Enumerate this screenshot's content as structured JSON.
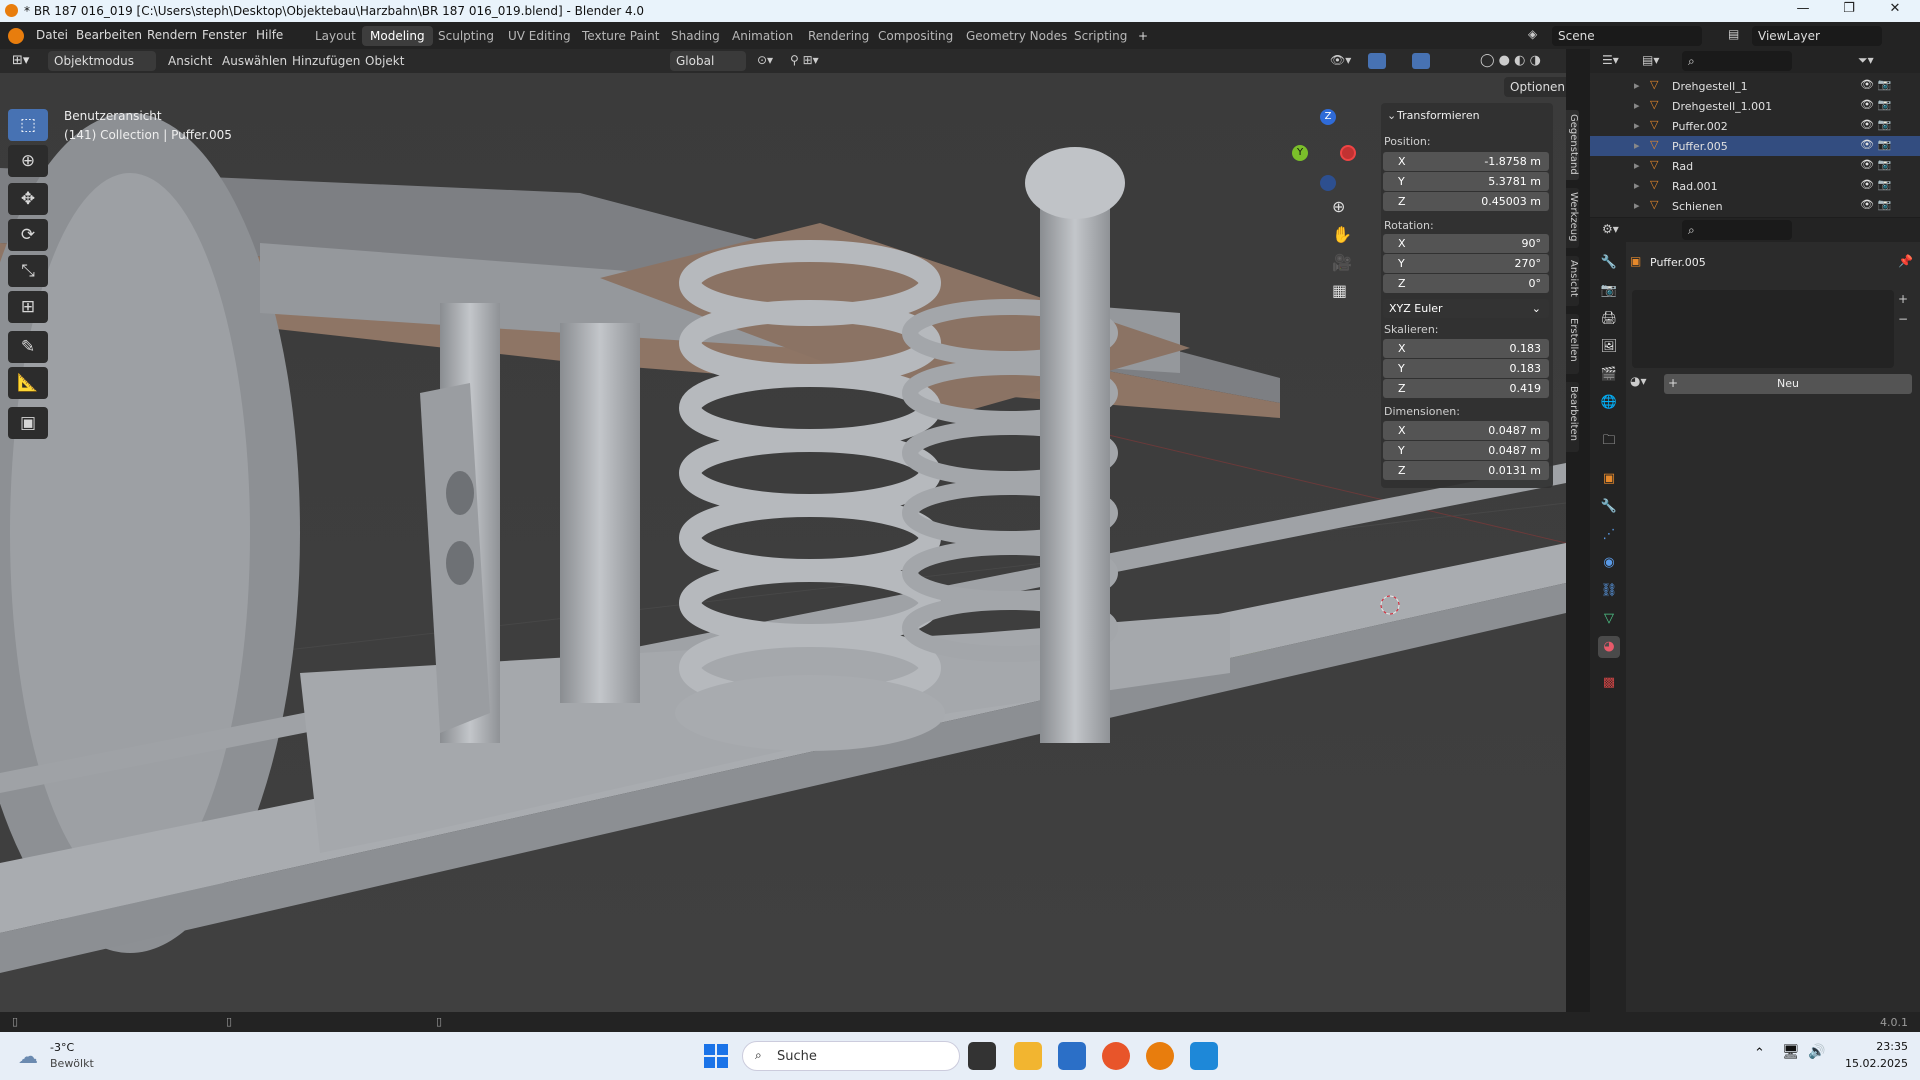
{
  "window": {
    "title": "* BR 187 016_019 [C:\\Users\\steph\\Desktop\\Objektebau\\Harzbahn\\BR 187 016_019.blend] - Blender 4.0",
    "controls": [
      "—",
      "❐",
      "✕"
    ]
  },
  "menu": [
    "Datei",
    "Bearbeiten",
    "Rendern",
    "Fenster",
    "Hilfe"
  ],
  "workspaces": [
    "Layout",
    "Modeling",
    "Sculpting",
    "UV Editing",
    "Texture Paint",
    "Shading",
    "Animation",
    "Rendering",
    "Compositing",
    "Geometry Nodes",
    "Scripting"
  ],
  "active_workspace": "Modeling",
  "add_workspace": "+",
  "scene": "Scene",
  "view_layer": "ViewLayer",
  "viewport_header": {
    "mode": "Objektmodus",
    "items": [
      "Ansicht",
      "Auswählen",
      "Hinzufügen",
      "Objekt"
    ],
    "orientation": "Global",
    "options": "Optionen"
  },
  "viewport": {
    "view_name": "Benutzeransicht",
    "context": "(141) Collection | Puffer.005",
    "gizmo": {
      "z": "Z",
      "y": "Y"
    }
  },
  "transform": {
    "header": "Transformieren",
    "position_label": "Position:",
    "position": [
      {
        "axis": "X",
        "value": "-1.8758 m"
      },
      {
        "axis": "Y",
        "value": "5.3781 m"
      },
      {
        "axis": "Z",
        "value": "0.45003 m"
      }
    ],
    "rotation_label": "Rotation:",
    "rotation": [
      {
        "axis": "X",
        "value": "90°"
      },
      {
        "axis": "Y",
        "value": "270°"
      },
      {
        "axis": "Z",
        "value": "0°"
      }
    ],
    "rotation_mode": "XYZ Euler",
    "scale_label": "Skalieren:",
    "scale": [
      {
        "axis": "X",
        "value": "0.183"
      },
      {
        "axis": "Y",
        "value": "0.183"
      },
      {
        "axis": "Z",
        "value": "0.419"
      }
    ],
    "dimensions_label": "Dimensionen:",
    "dimensions": [
      {
        "axis": "X",
        "value": "0.0487 m"
      },
      {
        "axis": "Y",
        "value": "0.0487 m"
      },
      {
        "axis": "Z",
        "value": "0.0131 m"
      }
    ]
  },
  "sidebar_tabs": [
    "Gegenstand",
    "Werkzeug",
    "Ansicht",
    "Erstellen",
    "Bearbeiten"
  ],
  "outliner": [
    "Drehgestell_1",
    "Drehgestell_1.001",
    "Puffer.002",
    "Puffer.005",
    "Rad",
    "Rad.001",
    "Schienen"
  ],
  "outliner_selected": 3,
  "properties": {
    "object_name": "Puffer.005",
    "new_button": "Neu"
  },
  "version": "4.0.1",
  "taskbar": {
    "temperature": "-3°C",
    "weather": "Bewölkt",
    "search": "Suche",
    "time": "23:35",
    "date": "15.02.2025"
  },
  "colors": {
    "accent": "#4772b3",
    "selection": "#334d80",
    "blender_orange": "#e87d0d"
  }
}
